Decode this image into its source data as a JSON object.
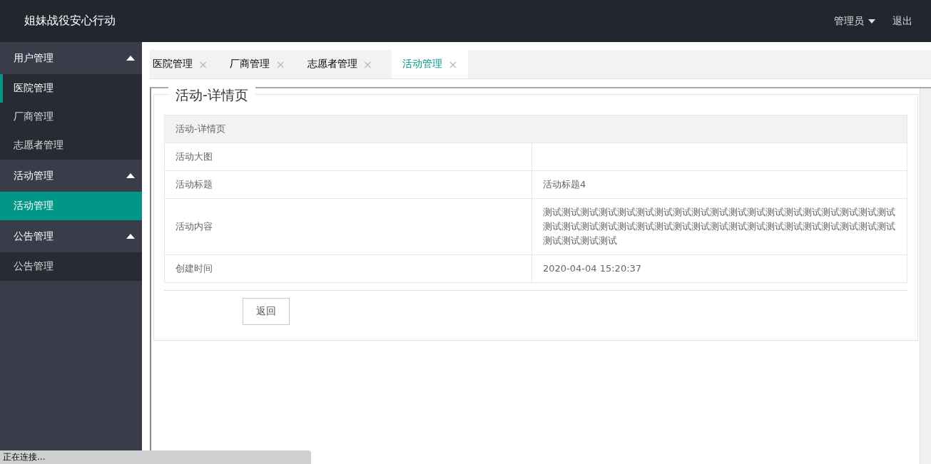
{
  "header": {
    "title": "姐妹战役安心行动",
    "user": "管理员",
    "logout": "退出"
  },
  "sidebar": {
    "groups": [
      {
        "label": "用户管理",
        "expanded": true,
        "items": [
          {
            "label": "医院管理",
            "selected": false,
            "focused": true
          },
          {
            "label": "厂商管理",
            "selected": false,
            "focused": false
          },
          {
            "label": "志愿者管理",
            "selected": false,
            "focused": false
          }
        ]
      },
      {
        "label": "活动管理",
        "expanded": true,
        "items": [
          {
            "label": "活动管理",
            "selected": true,
            "focused": false
          }
        ]
      },
      {
        "label": "公告管理",
        "expanded": true,
        "items": [
          {
            "label": "公告管理",
            "selected": false,
            "focused": false
          }
        ]
      }
    ]
  },
  "tabs": [
    {
      "label": "医院管理",
      "selected": false,
      "close": "×"
    },
    {
      "label": "厂商管理",
      "selected": false,
      "close": "×"
    },
    {
      "label": "志愿者管理",
      "selected": false,
      "close": "×"
    },
    {
      "label": "活动管理",
      "selected": true,
      "close": "×"
    }
  ],
  "detail": {
    "legend": "活动-详情页",
    "table_title": "活动-详情页",
    "rows": [
      {
        "label": "活动大图",
        "value": ""
      },
      {
        "label": "活动标题",
        "value": "活动标题4"
      },
      {
        "label": "活动内容",
        "value": "测试测试测试测试测试测试测试测试测试测试测试测试测试测试测试测试测试测试测试测试测试测试测试测试测试测试测试测试测试测试测试测试测试测试测试测试测试测试测试测试测试测试"
      },
      {
        "label": "创建时间",
        "value": "2020-04-04 15:20:37"
      }
    ],
    "back_button": "返回"
  },
  "status_bar": "正在连接..."
}
